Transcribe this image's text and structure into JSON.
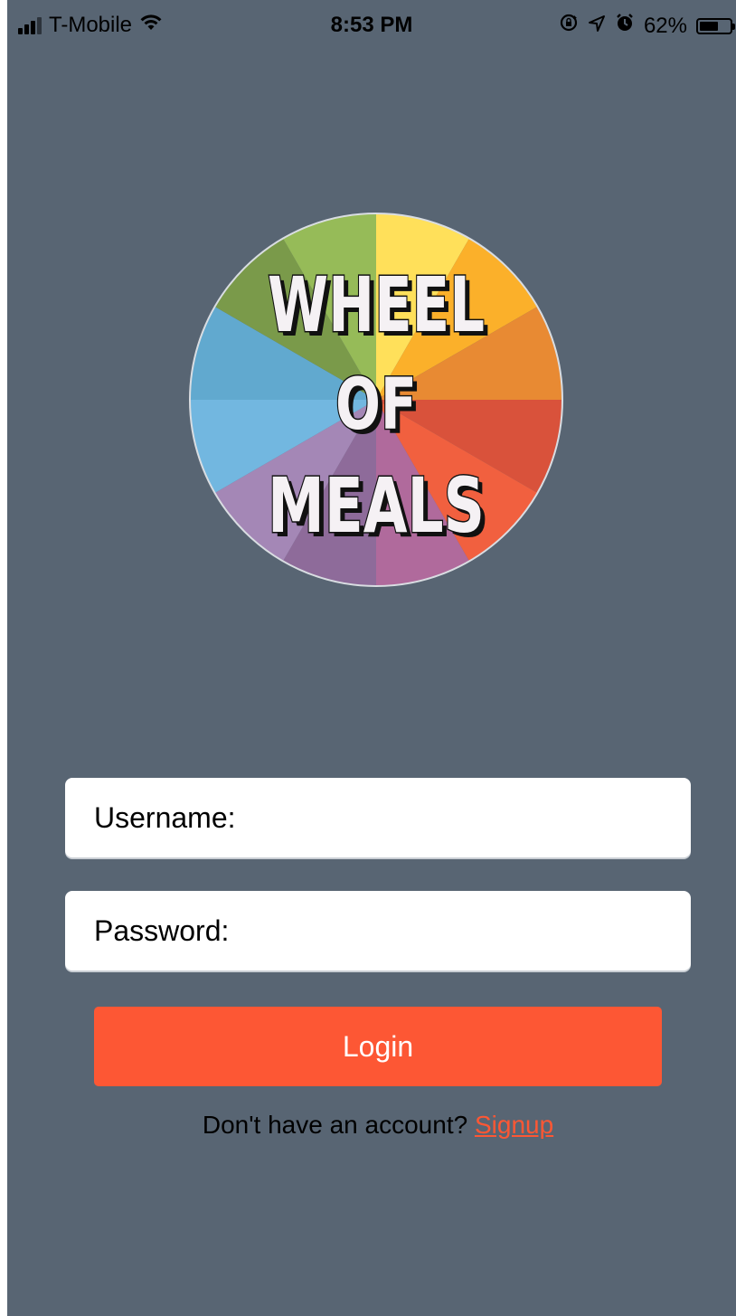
{
  "status_bar": {
    "carrier": "T-Mobile",
    "time": "8:53 PM",
    "battery_text": "62%",
    "battery_level": 0.62,
    "icons": [
      "signal-icon",
      "wifi-icon",
      "rotation-lock-icon",
      "location-icon",
      "alarm-icon",
      "battery-icon"
    ]
  },
  "logo": {
    "line1": "WHEEL",
    "line2": "OF",
    "line3": "MEALS",
    "wheel_colors": [
      "#ffe05a",
      "#fbb02a",
      "#e88a33",
      "#d9523b",
      "#f1603f",
      "#b06a9c",
      "#8e6b9a",
      "#a487b6",
      "#72b7e0",
      "#61a9cf",
      "#7a9a4a",
      "#96bb58"
    ]
  },
  "form": {
    "username_placeholder": "Username:",
    "password_placeholder": "Password:",
    "login_label": "Login",
    "signup_prompt": "Don't have an account?",
    "signup_label": "Signup"
  },
  "colors": {
    "background": "#586573",
    "accent": "#fd5734",
    "field_bg": "#ffffff"
  }
}
